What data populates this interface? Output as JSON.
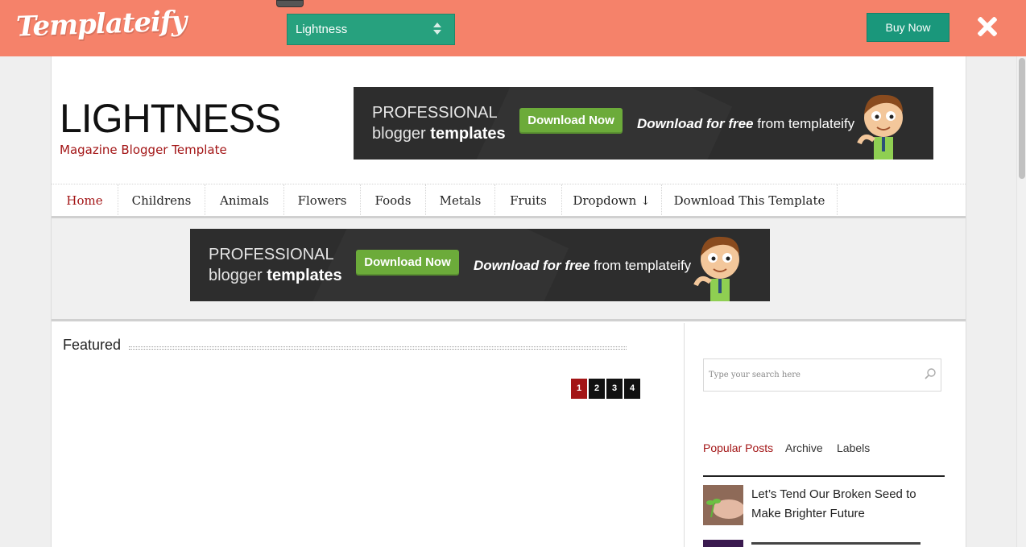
{
  "topbar": {
    "logo": "Templateify",
    "theme_select": "Lightness",
    "buy_label": "Buy Now",
    "background_color": "#f5826a",
    "accent_color": "#27a17e"
  },
  "site": {
    "title": "LIGHTNESS",
    "description": "Magazine Blogger Template",
    "accent_color": "#a31516"
  },
  "banner": {
    "line1": "PROFESSIONAL",
    "line2_a": "blogger ",
    "line2_b": "templates",
    "button": "Download Now",
    "free_a": "Download for free",
    "free_b": " from templateify"
  },
  "nav": {
    "items": [
      {
        "label": "Home"
      },
      {
        "label": "Childrens"
      },
      {
        "label": "Animals"
      },
      {
        "label": "Flowers"
      },
      {
        "label": "Foods"
      },
      {
        "label": "Metals"
      },
      {
        "label": "Fruits"
      },
      {
        "label": "Dropdown ↓"
      },
      {
        "label": "Download This Template"
      }
    ]
  },
  "main": {
    "featured_heading": "Featured",
    "pages": [
      "1",
      "2",
      "3",
      "4"
    ],
    "current_page": "1"
  },
  "sidebar": {
    "search_placeholder": "Type your search here",
    "tabs": [
      "Popular Posts",
      "Archive",
      "Labels"
    ],
    "active_tab": "Popular Posts",
    "posts": [
      {
        "title": "Let’s Tend Our Broken Seed to Make Brighter Future"
      }
    ]
  }
}
